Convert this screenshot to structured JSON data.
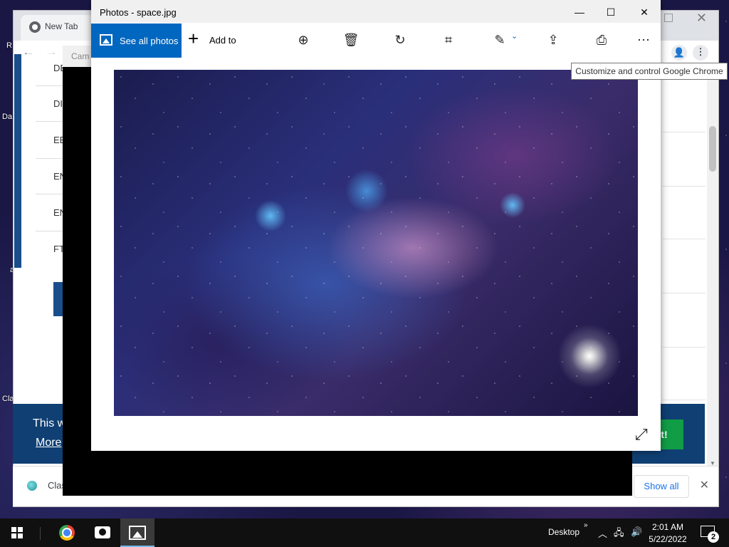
{
  "desktop": {
    "icon_fragments": [
      "R",
      "Da",
      "a",
      "Cla"
    ]
  },
  "chrome": {
    "tab_label": "New Tab",
    "left_entries": [
      "DE",
      "DI",
      "EE",
      "EN",
      "EN",
      "FT"
    ],
    "banner_text": "This w",
    "banner_more": "More",
    "banner_button": "it!",
    "download_item": "Clas",
    "show_all": "Show all",
    "tooltip": "Customize and control Google Chrome"
  },
  "camera": {
    "title_fragment": "Cam"
  },
  "photos": {
    "title": "Photos - space.jpg",
    "see_all": "See all photos",
    "add_to": "Add to"
  },
  "taskbar": {
    "desktop_label": "Desktop",
    "time": "2:01 AM",
    "date": "5/22/2022",
    "notification_count": "2"
  }
}
